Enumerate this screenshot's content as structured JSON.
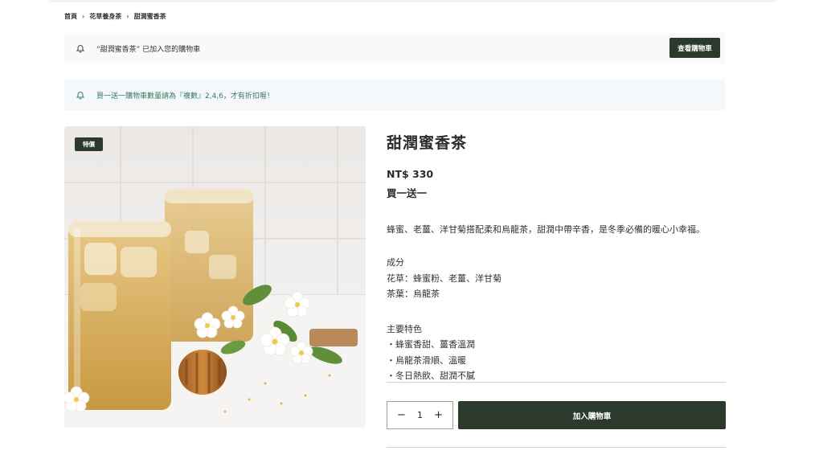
{
  "breadcrumb": {
    "home": "首頁",
    "category": "花草養身茶",
    "current": "甜潤蜜香茶"
  },
  "cart_notice": {
    "message": "“甜潤蜜香茶” 已加入您的購物車",
    "button_label": "查看購物車"
  },
  "promo_notice": {
    "message": "買一送一購物車數量請為『複數』2,4,6，才有折扣喔！"
  },
  "product": {
    "badge": "特價",
    "title": "甜潤蜜香茶",
    "price": "NT$ 330",
    "promo": "買一送一",
    "description": "蜂蜜、老薑、洋甘菊搭配柔和烏龍茶，甜潤中帶辛香，是冬季必備的暖心小幸福。",
    "ingredients_heading": "成分",
    "ingredients": [
      "花草：蜂蜜粉、老薑、洋甘菊",
      "茶葉：烏龍茶"
    ],
    "features_heading": "主要特色",
    "features": [
      "・蜂蜜香甜、薑香溫潤",
      "・烏龍茶滑順、溫暖",
      "・冬日熱飲、甜潤不膩"
    ]
  },
  "purchase": {
    "minus": "−",
    "quantity": "1",
    "plus": "+",
    "add_to_cart": "加入購物車"
  },
  "colors": {
    "primary_dark": "#2c3a2e",
    "promo_text": "#3c7a62"
  }
}
